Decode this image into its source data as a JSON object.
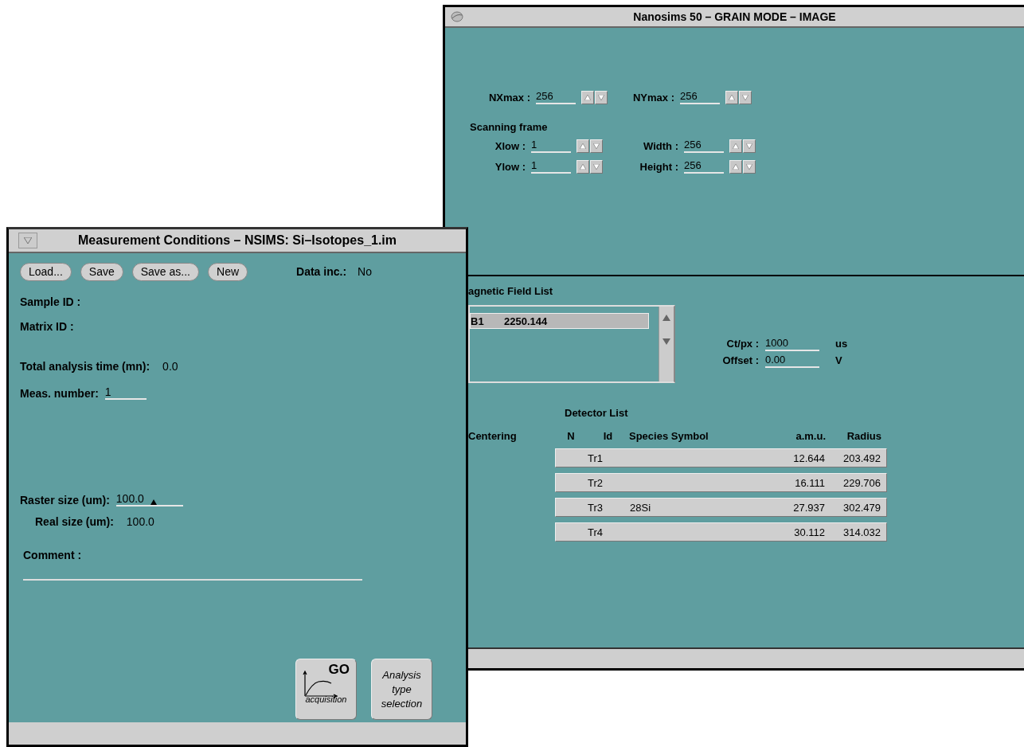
{
  "back_window": {
    "title": "Nanosims 50 – GRAIN MODE – IMAGE",
    "size_fields": [
      {
        "label": "NXmax :",
        "value": "256"
      },
      {
        "label": "NYmax :",
        "value": "256"
      }
    ],
    "scanning_frame": {
      "heading": "Scanning frame",
      "fields": [
        {
          "label": "Xlow :",
          "value": "1"
        },
        {
          "label": "Width :",
          "value": "256"
        },
        {
          "label": "Ylow :",
          "value": "1"
        },
        {
          "label": "Height :",
          "value": "256"
        }
      ]
    },
    "magnetic_field_list": {
      "heading": "agnetic Field List",
      "rows": [
        {
          "name": "B1",
          "value": "2250.144",
          "selected": true
        }
      ]
    },
    "acquisition_fields": [
      {
        "label": "Ct/px :",
        "value": "1000",
        "unit": "us"
      },
      {
        "label": "Offset :",
        "value": "0.00",
        "unit": "V"
      }
    ],
    "detector_list": {
      "heading": "Detector List",
      "columns": [
        "Centering",
        "N",
        "Id",
        "Species Symbol",
        "a.m.u.",
        "Radius"
      ],
      "rows": [
        {
          "id": "Tr1",
          "amu": "12.644",
          "radius": "203.492"
        },
        {
          "id": "Tr2",
          "amu": "16.111",
          "radius": "229.706"
        },
        {
          "id": "Tr3",
          "species": "28Si",
          "amu": "27.937",
          "radius": "302.479"
        },
        {
          "id": "Tr4",
          "amu": "30.112",
          "radius": "314.032"
        }
      ]
    }
  },
  "front_window": {
    "title": "Measurement Conditions – NSIMS: Si–Isotopes_1.im",
    "buttons": [
      "Load...",
      "Save",
      "Save as...",
      "New"
    ],
    "data_inc": {
      "label": "Data inc.:",
      "value": "No"
    },
    "sample_id": {
      "label": "Sample ID :"
    },
    "matrix_id": {
      "label": "Matrix ID :"
    },
    "total_time": {
      "label": "Total analysis time (mn):",
      "value": "0.0"
    },
    "meas_number": {
      "label": "Meas. number:",
      "value": "1"
    },
    "raster_size": {
      "label": "Raster size (um):",
      "value": "100.0"
    },
    "real_size": {
      "label": "Real size (um):",
      "value": "100.0"
    },
    "comment": {
      "label": "Comment :"
    },
    "go_button": {
      "title": "GO",
      "caption": "acquisition"
    },
    "analysis_button": {
      "lines": [
        "Analysis",
        "type",
        "selection"
      ]
    }
  }
}
